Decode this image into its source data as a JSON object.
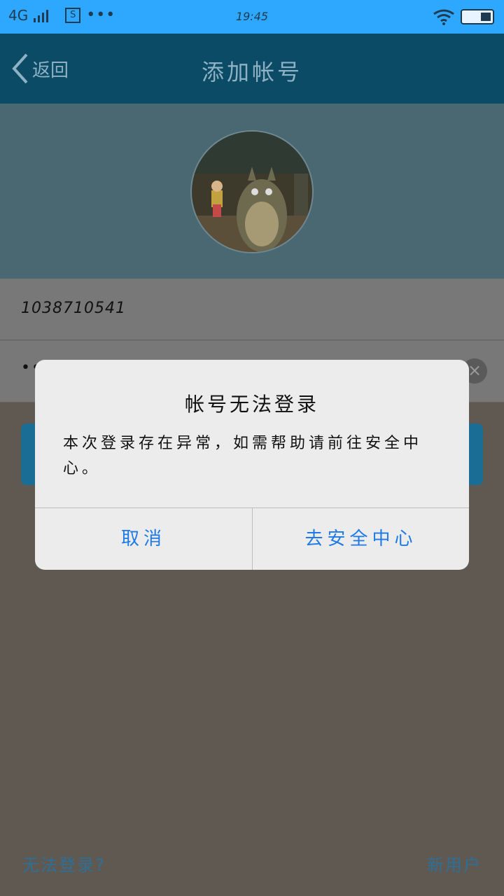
{
  "status_bar": {
    "network": "4G",
    "time": "19:45",
    "screenshot_icon": "S",
    "more_dots": "•••"
  },
  "nav": {
    "back_label": "返回",
    "title": "添加帐号"
  },
  "form": {
    "account_value": "1038710541",
    "password_mask": "••••••",
    "clear_icon": "×"
  },
  "dialog": {
    "title": "帐号无法登录",
    "message": "本次登录存在异常，如需帮助请前往安全中心。",
    "cancel_label": "取消",
    "confirm_label": "去安全中心"
  },
  "footer": {
    "cannot_login_label": "无法登录?",
    "new_user_label": "新用户"
  },
  "colors": {
    "status_bar": "#2ea8ff",
    "nav_bar": "#0b4b66",
    "dialog_button_text": "#1d7ae6",
    "link_text": "#2e6f97"
  }
}
